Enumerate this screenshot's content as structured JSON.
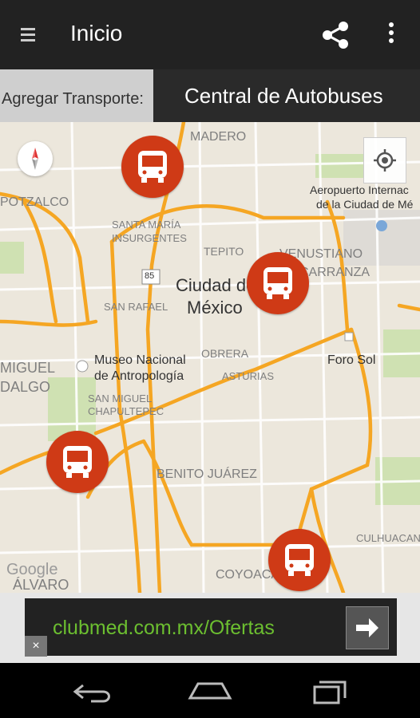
{
  "appbar": {
    "title": "Inicio"
  },
  "transport": {
    "label": "Agregar Transporte:",
    "selected": "Central de Autobuses"
  },
  "map": {
    "labels": [
      "MADERO",
      "POTZALCO",
      "SANTA MARÍA",
      "INSURGENTES",
      "TEPITO",
      "VENUSTIANO",
      "CARRANZA",
      "Aeropuerto Internac",
      "de la Ciudad de Mé",
      "Ciudad de",
      "México",
      "SAN RAFAEL",
      "Museo Nacional",
      "de Antropología",
      "OBRERA",
      "ASTURIAS",
      "Foro Sol",
      "MIGUEL",
      "DALGO",
      "SAN MIGUEL",
      "CHAPULTEPEC",
      "BENITO JUÁREZ",
      "CULHUACAN",
      "COYOACÁ",
      "ÁLVARO",
      "Google",
      "85"
    ]
  },
  "ad": {
    "text": "clubmed.com.mx/Ofertas",
    "close": "×"
  }
}
